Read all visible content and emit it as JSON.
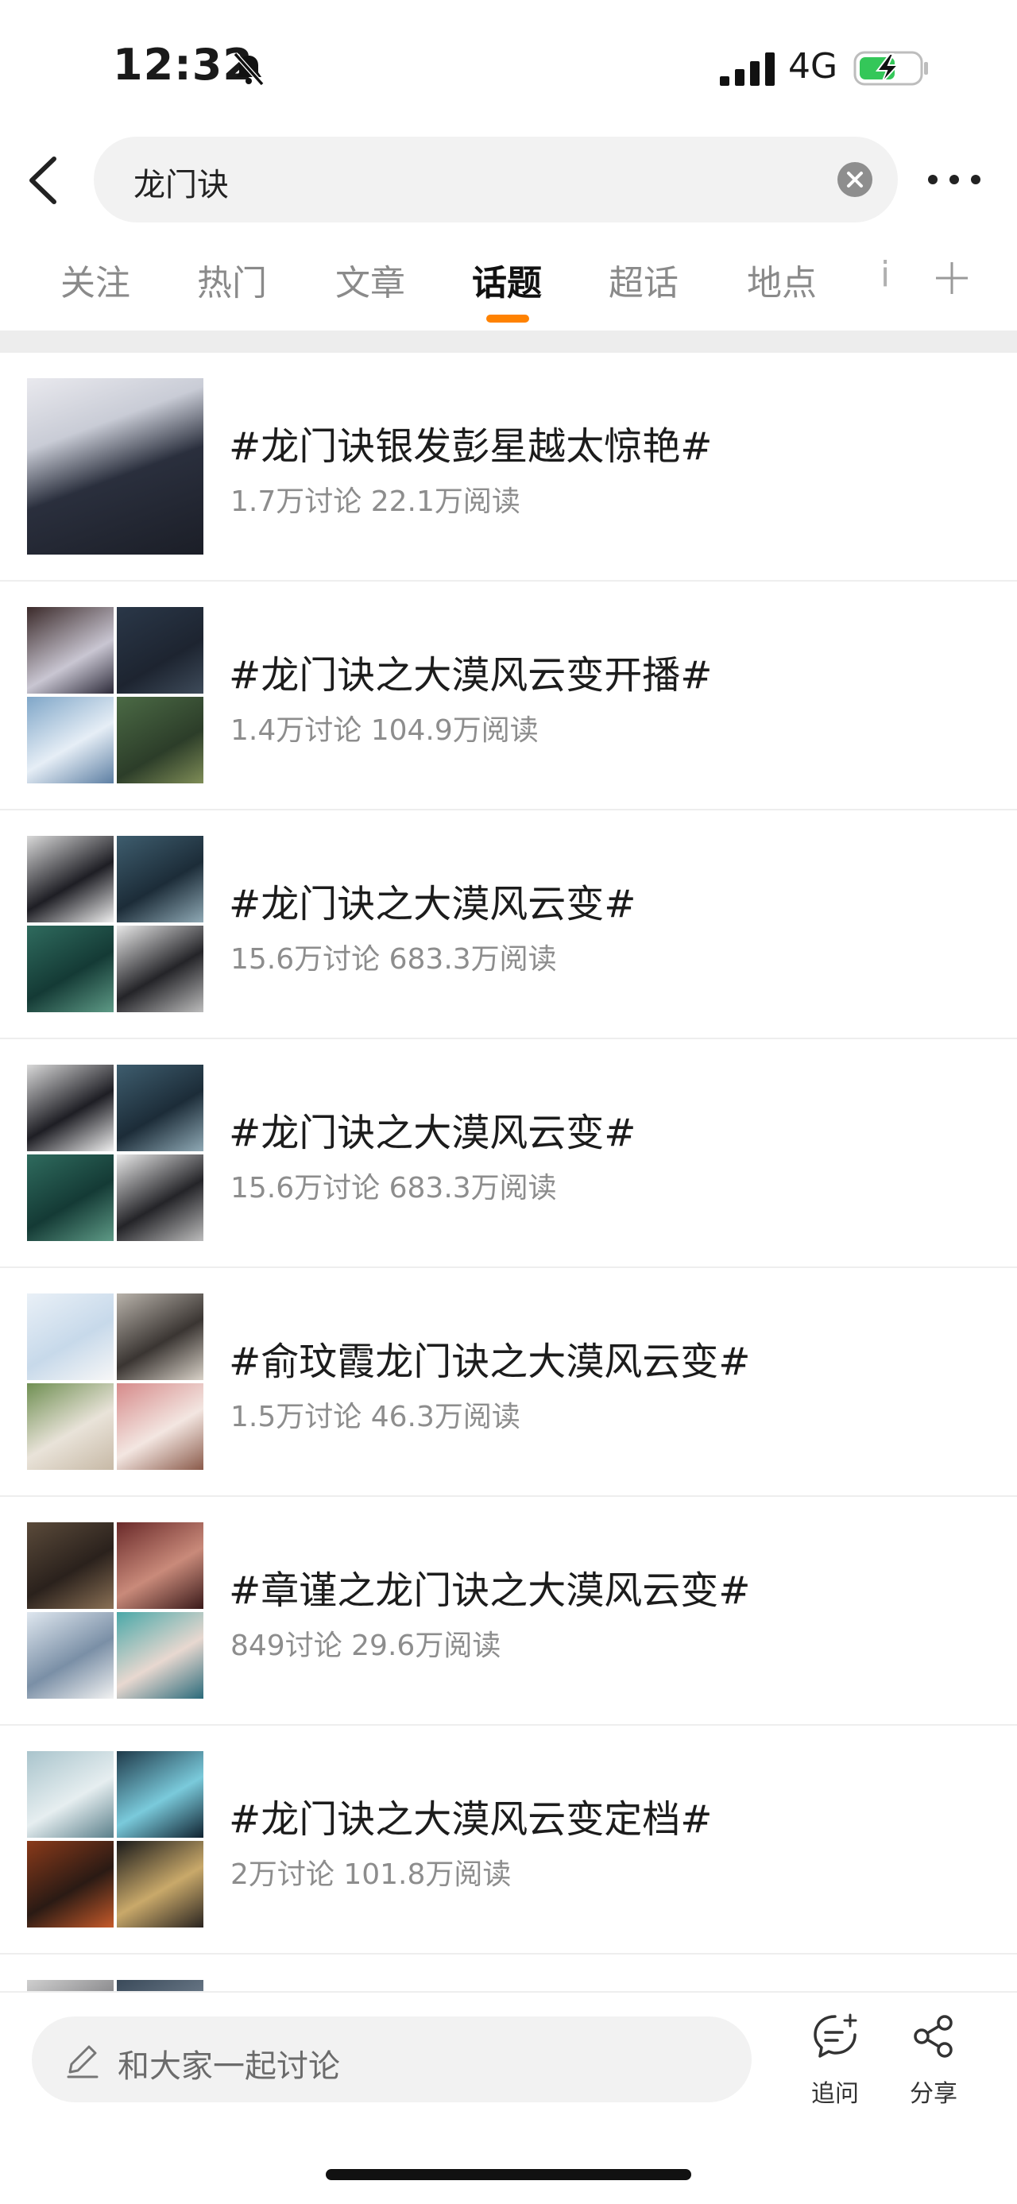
{
  "status_bar": {
    "time": "12:32",
    "network": "4G",
    "icons": [
      "bell-muted-icon",
      "signal-icon",
      "battery-charging-icon"
    ],
    "battery_level": 0.55
  },
  "search": {
    "query": "龙门诀",
    "icons": [
      "back-icon",
      "clear-icon",
      "more-icon"
    ]
  },
  "tabs": {
    "items": [
      "关注",
      "热门",
      "文章",
      "话题",
      "超话",
      "地点"
    ],
    "active": "话题",
    "overflow": "i",
    "accent_color": "#ff8200"
  },
  "topics": [
    {
      "title": "#龙门诀银发彭星越太惊艳#",
      "meta": "1.7万讨论 22.1万阅读"
    },
    {
      "title": "#龙门诀之大漠风云变开播#",
      "meta": "1.4万讨论 104.9万阅读"
    },
    {
      "title": "#龙门诀之大漠风云变#",
      "meta": "15.6万讨论 683.3万阅读"
    },
    {
      "title": "#龙门诀之大漠风云变#",
      "meta": "15.6万讨论 683.3万阅读"
    },
    {
      "title": "#俞玟霞龙门诀之大漠风云变#",
      "meta": "1.5万讨论 46.3万阅读"
    },
    {
      "title": "#章谨之龙门诀之大漠风云变#",
      "meta": "849讨论 29.6万阅读"
    },
    {
      "title": "#龙门诀之大漠风云变定档#",
      "meta": "2万讨论 101.8万阅读"
    }
  ],
  "bottom_bar": {
    "discuss_placeholder": "和大家一起讨论",
    "ask_label": "追问",
    "share_label": "分享"
  }
}
